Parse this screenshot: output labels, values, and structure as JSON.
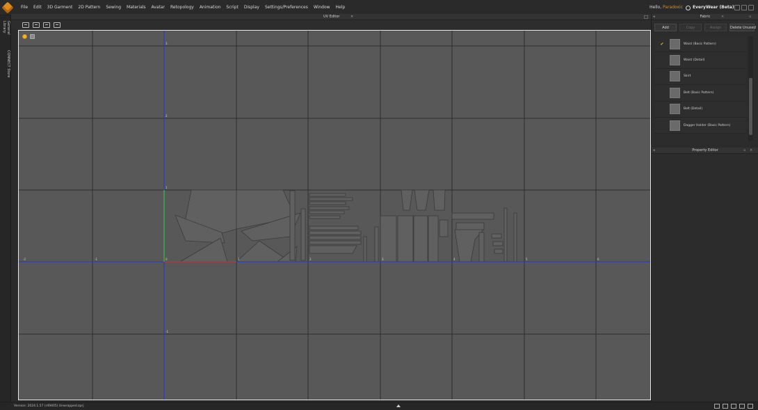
{
  "menu": {
    "items": [
      "File",
      "Edit",
      "3D Garment",
      "2D Pattern",
      "Sewing",
      "Materials",
      "Avatar",
      "Retopology",
      "Animation",
      "Script",
      "Display",
      "Settings/Preferences",
      "Window",
      "Help"
    ],
    "greeting_prefix": "Hello,",
    "user": "Paradoxic",
    "product": "EveryWear (Beta)"
  },
  "left_strip": {
    "tabs": [
      "Library",
      "General",
      "CONNECT Store"
    ]
  },
  "uv_editor": {
    "title": "UV Editor",
    "close_label": "×",
    "axis_labels": {
      "x": [
        "-2",
        "-1",
        "0",
        "1",
        "2",
        "3",
        "4",
        "5",
        "6"
      ],
      "y": [
        "3",
        "2",
        "1",
        "-1"
      ]
    }
  },
  "fabric": {
    "title": "Fabric",
    "buttons": {
      "add": "Add",
      "copy": "Copy",
      "assign": "Assign",
      "delete_unused": "Delete Unused"
    },
    "items": [
      {
        "name": "Waist (Basic Pattern)",
        "check": "✔"
      },
      {
        "name": "Waist (Detail)",
        "check": ""
      },
      {
        "name": "Skirt",
        "check": ""
      },
      {
        "name": "Belt (Basic Pattern)",
        "check": ""
      },
      {
        "name": "Belt (Detail)",
        "check": ""
      },
      {
        "name": "Dagger Holder (Basic Pattern)",
        "check": ""
      }
    ]
  },
  "property_editor": {
    "title": "Property Editor"
  },
  "status": {
    "version": "Version:   2024.1.57 (r49405)    Unwrapped.zprj"
  },
  "colors": {
    "accent": "#e08a1e",
    "viewport_bg": "#585858",
    "u_axis": "#2a3dc0",
    "v_axis_positive": "#3fbf3f",
    "u_axis_positive": "#c03a2a"
  }
}
